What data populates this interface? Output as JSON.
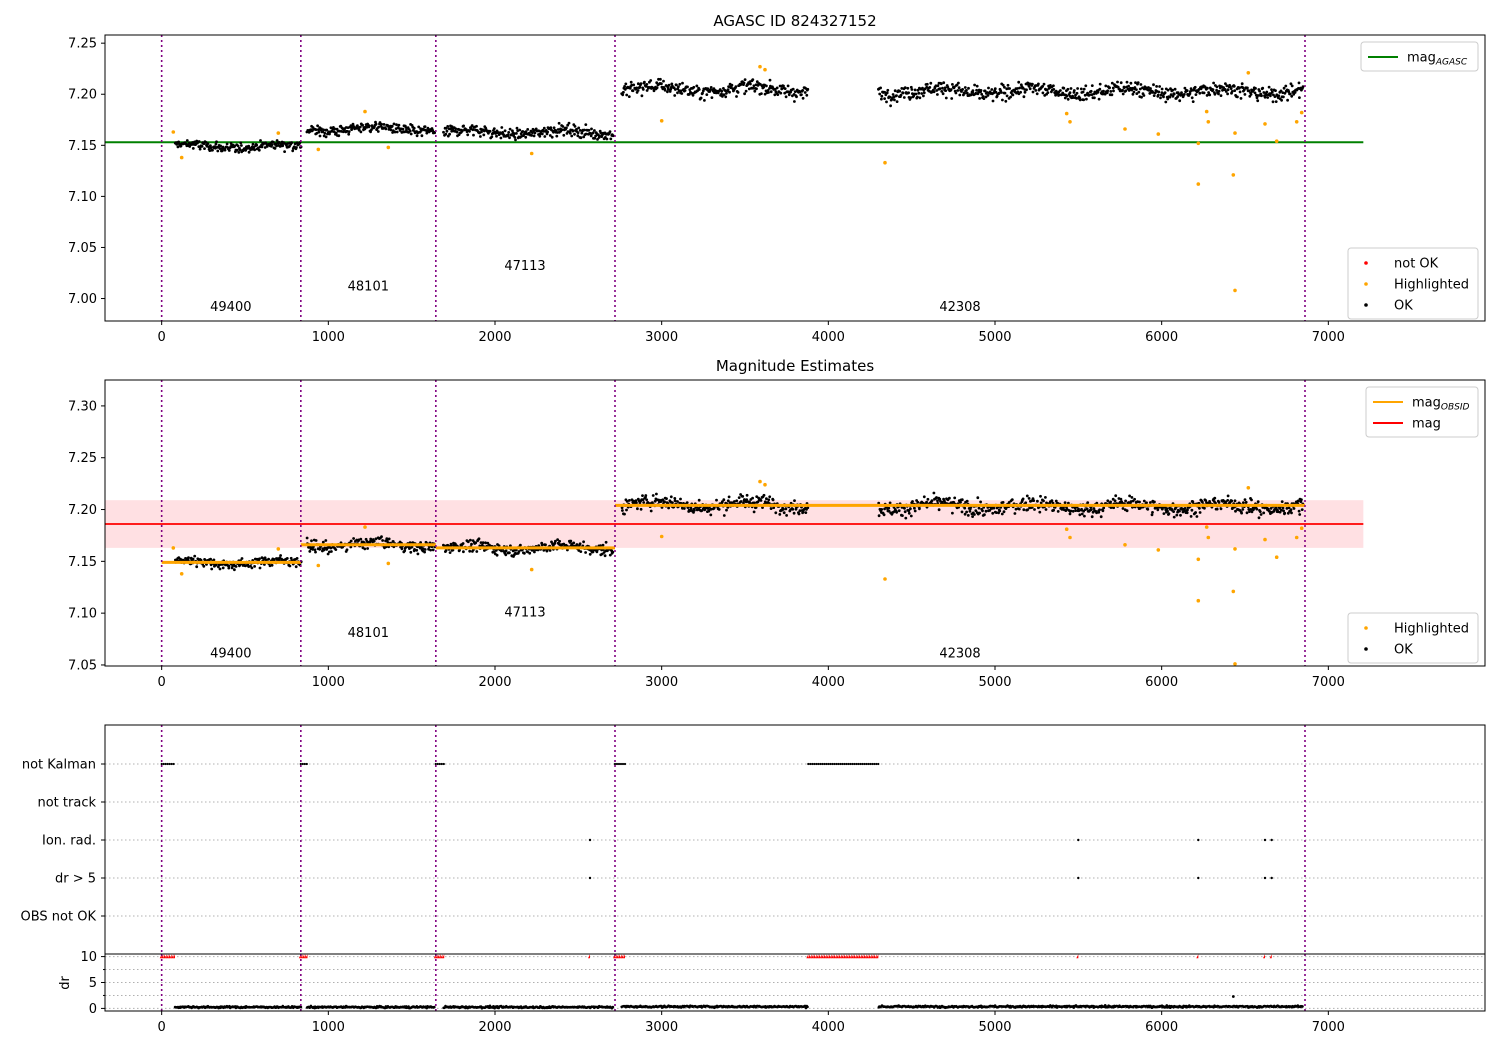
{
  "figure": {
    "colors": {
      "ok": "#000000",
      "highlighted": "#ffa500",
      "not_ok": "#ff0000",
      "mag_agasc": "#008000",
      "mag_obsid": "#ffa500",
      "mag": "#ff0000",
      "mag_band": "#ffe0e3",
      "obsid_line": "#800080"
    },
    "obsid_boundaries": [
      0,
      835,
      1645,
      2720,
      6860
    ]
  },
  "chart_data": [
    {
      "type": "scatter",
      "title": "AGASC ID 824327152",
      "xlim": [
        -340,
        7940
      ],
      "ylim": [
        6.978,
        7.258
      ],
      "x_ticks": [
        0,
        1000,
        2000,
        3000,
        4000,
        5000,
        6000,
        7000
      ],
      "y_ticks": [
        7.0,
        7.05,
        7.1,
        7.15,
        7.2,
        7.25
      ],
      "grid": false,
      "legend_top": {
        "position": "upper-right",
        "entries": [
          {
            "label": "mag",
            "sub": "AGASC",
            "marker": "line",
            "color": "#008000"
          }
        ]
      },
      "legend_bottom": {
        "position": "lower-right",
        "entries": [
          {
            "label": "not OK",
            "marker": "dot",
            "color": "#ff0000"
          },
          {
            "label": "Highlighted",
            "marker": "dot",
            "color": "#ffa500"
          },
          {
            "label": "OK",
            "marker": "dot",
            "color": "#000000"
          }
        ]
      },
      "mag_agasc": {
        "value": 7.153,
        "x": [
          -340,
          7210
        ]
      },
      "obsid_labels": [
        {
          "text": "49400",
          "x": 415,
          "y": 6.988
        },
        {
          "text": "48101",
          "x": 1240,
          "y": 7.008
        },
        {
          "text": "47113",
          "x": 2180,
          "y": 7.028
        },
        {
          "text": "42308",
          "x": 4790,
          "y": 6.988
        }
      ],
      "ok_segments": [
        {
          "x": [
            80,
            840
          ],
          "mean": 7.149,
          "spread": 0.006
        },
        {
          "x": [
            870,
            1640
          ],
          "mean": 7.166,
          "spread": 0.007
        },
        {
          "x": [
            1690,
            2710
          ],
          "mean": 7.163,
          "spread": 0.007
        },
        {
          "x": [
            2760,
            3880
          ],
          "mean": 7.205,
          "spread": 0.009
        },
        {
          "x": [
            4300,
            6850
          ],
          "mean": 7.203,
          "spread": 0.009
        }
      ],
      "highlighted_points": [
        [
          70,
          7.163
        ],
        [
          120,
          7.138
        ],
        [
          700,
          7.162
        ],
        [
          940,
          7.146
        ],
        [
          1220,
          7.183
        ],
        [
          1360,
          7.148
        ],
        [
          2220,
          7.142
        ],
        [
          3000,
          7.174
        ],
        [
          3590,
          7.227
        ],
        [
          3620,
          7.224
        ],
        [
          4340,
          7.133
        ],
        [
          5430,
          7.181
        ],
        [
          5450,
          7.173
        ],
        [
          5780,
          7.166
        ],
        [
          5980,
          7.161
        ],
        [
          6220,
          7.152
        ],
        [
          6220,
          7.112
        ],
        [
          6270,
          7.183
        ],
        [
          6280,
          7.173
        ],
        [
          6430,
          7.121
        ],
        [
          6440,
          7.162
        ],
        [
          6440,
          7.008
        ],
        [
          6520,
          7.221
        ],
        [
          6620,
          7.171
        ],
        [
          6690,
          7.154
        ],
        [
          6810,
          7.173
        ],
        [
          6840,
          7.182
        ]
      ]
    },
    {
      "type": "scatter",
      "title": "Magnitude Estimates",
      "xlim": [
        -340,
        7940
      ],
      "ylim": [
        7.049,
        7.325
      ],
      "x_ticks": [
        0,
        1000,
        2000,
        3000,
        4000,
        5000,
        6000,
        7000
      ],
      "y_ticks": [
        7.05,
        7.1,
        7.15,
        7.2,
        7.25,
        7.3
      ],
      "grid": false,
      "legend_top": {
        "position": "upper-right",
        "entries": [
          {
            "label": "mag",
            "sub": "OBSID",
            "marker": "line",
            "color": "#ffa500"
          },
          {
            "label": "mag",
            "sub": "",
            "marker": "line",
            "color": "#ff0000"
          }
        ]
      },
      "legend_bottom": {
        "position": "lower-right",
        "entries": [
          {
            "label": "Highlighted",
            "marker": "dot",
            "color": "#ffa500"
          },
          {
            "label": "OK",
            "marker": "dot",
            "color": "#000000"
          }
        ]
      },
      "mag": {
        "value": 7.186,
        "band": [
          7.163,
          7.209
        ],
        "x": [
          -340,
          7210
        ]
      },
      "mag_obsid": [
        {
          "x": [
            0,
            835
          ],
          "value": 7.149
        },
        {
          "x": [
            835,
            1645
          ],
          "value": 7.166
        },
        {
          "x": [
            1645,
            2720
          ],
          "value": 7.163
        },
        {
          "x": [
            2720,
            6860
          ],
          "value": 7.204
        }
      ],
      "obsid_labels": [
        {
          "text": "49400",
          "x": 415,
          "y": 7.057
        },
        {
          "text": "48101",
          "x": 1240,
          "y": 7.077
        },
        {
          "text": "47113",
          "x": 2180,
          "y": 7.097
        },
        {
          "text": "42308",
          "x": 4790,
          "y": 7.057
        }
      ],
      "ok_segments": [
        {
          "x": [
            80,
            840
          ],
          "mean": 7.149,
          "spread": 0.006
        },
        {
          "x": [
            870,
            1640
          ],
          "mean": 7.166,
          "spread": 0.007
        },
        {
          "x": [
            1690,
            2710
          ],
          "mean": 7.163,
          "spread": 0.007
        },
        {
          "x": [
            2760,
            3880
          ],
          "mean": 7.205,
          "spread": 0.009
        },
        {
          "x": [
            4300,
            6850
          ],
          "mean": 7.203,
          "spread": 0.009
        }
      ],
      "highlighted_points": [
        [
          70,
          7.163
        ],
        [
          120,
          7.138
        ],
        [
          700,
          7.162
        ],
        [
          940,
          7.146
        ],
        [
          1220,
          7.183
        ],
        [
          1360,
          7.148
        ],
        [
          2220,
          7.142
        ],
        [
          3000,
          7.174
        ],
        [
          3590,
          7.227
        ],
        [
          3620,
          7.224
        ],
        [
          4340,
          7.133
        ],
        [
          5430,
          7.181
        ],
        [
          5450,
          7.173
        ],
        [
          5780,
          7.166
        ],
        [
          5980,
          7.161
        ],
        [
          6220,
          7.152
        ],
        [
          6220,
          7.112
        ],
        [
          6270,
          7.183
        ],
        [
          6280,
          7.173
        ],
        [
          6430,
          7.121
        ],
        [
          6440,
          7.162
        ],
        [
          6440,
          7.051
        ],
        [
          6520,
          7.221
        ],
        [
          6620,
          7.171
        ],
        [
          6690,
          7.154
        ],
        [
          6810,
          7.173
        ],
        [
          6840,
          7.182
        ]
      ]
    },
    {
      "type": "scatter",
      "title": "",
      "xlim": [
        -340,
        7940
      ],
      "y_categories": [
        "not Kalman",
        "not track",
        "Ion. rad.",
        "dr > 5",
        "OBS not OK"
      ],
      "grid": true,
      "flags": {
        "not Kalman": [
          [
            0,
            80
          ],
          [
            835,
            880
          ],
          [
            1645,
            1700
          ],
          [
            2720,
            2780
          ],
          [
            3880,
            4300
          ]
        ],
        "Ion. rad.": [
          2570,
          5500,
          6220,
          6620,
          6660
        ],
        "dr > 5": [
          2570,
          5500,
          6220,
          6620,
          6660
        ]
      }
    },
    {
      "type": "scatter",
      "title": "",
      "ylabel": "dr",
      "xlim": [
        -340,
        7940
      ],
      "ylim": [
        -0.5,
        10.5
      ],
      "x_ticks": [
        0,
        1000,
        2000,
        3000,
        4000,
        5000,
        6000,
        7000
      ],
      "y_ticks": [
        0,
        5,
        10
      ],
      "grid": true,
      "clipped_value": 10,
      "clipped_ranges": [
        [
          0,
          80
        ],
        [
          835,
          880
        ],
        [
          1645,
          1700
        ],
        [
          2720,
          2780
        ],
        [
          3880,
          4300
        ]
      ],
      "clipped_points": [
        2570,
        5500,
        6220,
        6620,
        6660
      ],
      "dr_segments": [
        {
          "x": [
            80,
            840
          ],
          "mean": 0.25
        },
        {
          "x": [
            870,
            1640
          ],
          "mean": 0.25
        },
        {
          "x": [
            1690,
            2710
          ],
          "mean": 0.25
        },
        {
          "x": [
            2760,
            3880
          ],
          "mean": 0.35
        },
        {
          "x": [
            4300,
            6850
          ],
          "mean": 0.35
        }
      ],
      "dr_outliers": [
        [
          6430,
          2.3
        ]
      ]
    }
  ]
}
